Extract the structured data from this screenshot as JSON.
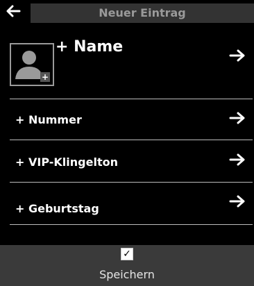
{
  "header": {
    "title": "Neuer Eintrag",
    "back_icon": "back-arrow-icon"
  },
  "entry": {
    "name_label": "+ Name",
    "photo_icon": "person-icon",
    "photo_badge": "+"
  },
  "rows": [
    {
      "label": "+ Nummer",
      "icon": "forward-arrow-icon"
    },
    {
      "label": "+ VIP-Klingelton",
      "icon": "forward-arrow-icon"
    },
    {
      "label": "+ Geburtstag",
      "icon": "forward-arrow-icon"
    }
  ],
  "footer": {
    "checkbox_glyph": "✓",
    "save_label": "Speichern"
  },
  "colors": {
    "background": "#000000",
    "header_bar": "#333333",
    "footer_bar": "#3a3a3a",
    "divider": "#bdbdbd"
  }
}
